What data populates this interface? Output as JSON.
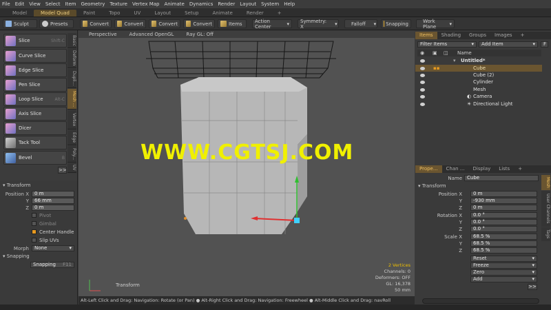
{
  "menu": [
    "File",
    "Edit",
    "View",
    "Select",
    "Item",
    "Geometry",
    "Texture",
    "Vertex Map",
    "Animate",
    "Dynamics",
    "Render",
    "Layout",
    "System",
    "Help"
  ],
  "layout_tabs": [
    "Model",
    "Model Quad",
    "Paint",
    "Topo",
    "UV",
    "Layout",
    "Setup",
    "Animate",
    "Render",
    "+"
  ],
  "toolbar": {
    "sculpt": "Sculpt",
    "presets": "Presets",
    "convert": "Convert",
    "items": "Items",
    "action_center": "Action Center",
    "symmetry": "Symmetry: X",
    "falloff": "Falloff",
    "snapping": "Snapping",
    "work_plane": "Work Plane"
  },
  "tools": [
    {
      "label": "Slice",
      "shortcut": "Shift-C"
    },
    {
      "label": "Curve Slice",
      "shortcut": ""
    },
    {
      "label": "Edge Slice",
      "shortcut": ""
    },
    {
      "label": "Pen Slice",
      "shortcut": ""
    },
    {
      "label": "Loop Slice",
      "shortcut": "Alt-C"
    },
    {
      "label": "Axis Slice",
      "shortcut": ""
    },
    {
      "label": "Dicer",
      "shortcut": ""
    },
    {
      "label": "Tack Tool",
      "shortcut": ""
    },
    {
      "label": "Bevel",
      "shortcut": "B"
    }
  ],
  "left_vtabs": [
    "Basic",
    "Deform",
    "Dupli...",
    "Mesh ...",
    "Vertex",
    "Edge",
    "Poly...",
    "UV"
  ],
  "left_more": ">>",
  "transform": {
    "section": "Transform",
    "pos_label": "Position X",
    "y_label": "Y",
    "z_label": "Z",
    "x": "0 m",
    "y": "66 mm",
    "z": "0 m",
    "pivot": "Pivot",
    "gimbal": "Gimbal",
    "center_handle": "Center Handle",
    "slip_uvs": "Slip UVs",
    "morph_label": "Morph",
    "morph_value": "None",
    "snapping_section": "Snapping",
    "snapping_value": "Snapping",
    "snapping_key": "F11"
  },
  "viewport": {
    "perspective": "Perspective",
    "shading": "Advanced OpenGL",
    "raygl": "Ray GL: Off",
    "watermark": "WWW.CGTSJ.COM",
    "tool_name": "Transform",
    "hud": {
      "vertices": "2 Vertices",
      "channels": "Channels: 0",
      "deformers": "Deformers: OFF",
      "gl": "GL: 16,378",
      "lens": "50 mm"
    }
  },
  "status": "Alt-Left Click and Drag: Navigation: Rotate (or Pan) ● Alt-Right Click and Drag: Navigation: Freewheel ● Alt-Middle Click and Drag: navRoll",
  "items_panel": {
    "tabs": [
      "Items",
      "Shading",
      "Groups",
      "Images",
      "+"
    ],
    "filter": "Filter Items",
    "add": "Add Item",
    "F": "F",
    "name_col": "Name",
    "rows": [
      {
        "label": "Untitled*"
      },
      {
        "label": "Cube"
      },
      {
        "label": "Cube (2)"
      },
      {
        "label": "Cylinder"
      },
      {
        "label": "Mesh"
      },
      {
        "label": "Camera"
      },
      {
        "label": "Directional Light"
      }
    ]
  },
  "props_panel": {
    "tabs": [
      "Prope...",
      "Chan ...",
      "Display",
      "Lists",
      "+"
    ],
    "name_label": "Name",
    "name_value": "Cube",
    "transform": "Transform",
    "pos_label": "Position X",
    "y": "Y",
    "z": "Z",
    "px": "0 m",
    "py": "-930 mm",
    "pz": "0 m",
    "rot_label": "Rotation X",
    "rx": "0.0 °",
    "ry": "0.0 °",
    "rz": "0.0 °",
    "scale_label": "Scale X",
    "sx": "68.5 %",
    "sy": "68.5 %",
    "sz": "68.5 %",
    "reset": "Reset",
    "freeze": "Freeze",
    "zero": "Zero",
    "add": "Add",
    "more": ">>",
    "vtabs": [
      "Mesh",
      "User Channels",
      "Tags"
    ]
  }
}
